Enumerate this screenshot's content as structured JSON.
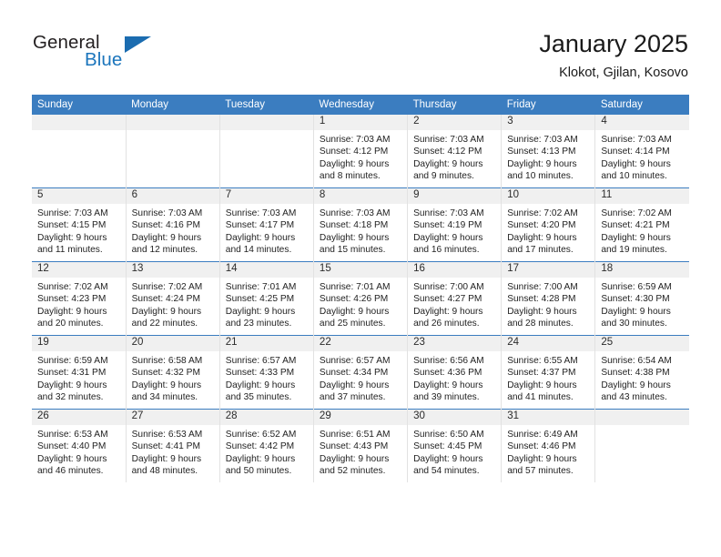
{
  "brand": {
    "word_one": "General",
    "word_two": "Blue",
    "accent_color": "#1b75bc",
    "triangle_color": "#1b6cb0",
    "triangle_icon": "triangle-right-icon"
  },
  "header": {
    "title": "January 2025",
    "subtitle": "Klokot, Gjilan, Kosovo"
  },
  "theme": {
    "header_row_bg": "#3b7dc0",
    "header_row_text": "#ffffff",
    "daynum_band_bg": "#f0f0f0",
    "cell_bg": "#ffffff",
    "grid_line": "#e2e2e2"
  },
  "calendar": {
    "weekday_headers": [
      "Sunday",
      "Monday",
      "Tuesday",
      "Wednesday",
      "Thursday",
      "Friday",
      "Saturday"
    ],
    "weeks": [
      [
        {
          "day": "",
          "lines": []
        },
        {
          "day": "",
          "lines": []
        },
        {
          "day": "",
          "lines": []
        },
        {
          "day": "1",
          "lines": [
            "Sunrise: 7:03 AM",
            "Sunset: 4:12 PM",
            "Daylight: 9 hours",
            "and 8 minutes."
          ]
        },
        {
          "day": "2",
          "lines": [
            "Sunrise: 7:03 AM",
            "Sunset: 4:12 PM",
            "Daylight: 9 hours",
            "and 9 minutes."
          ]
        },
        {
          "day": "3",
          "lines": [
            "Sunrise: 7:03 AM",
            "Sunset: 4:13 PM",
            "Daylight: 9 hours",
            "and 10 minutes."
          ]
        },
        {
          "day": "4",
          "lines": [
            "Sunrise: 7:03 AM",
            "Sunset: 4:14 PM",
            "Daylight: 9 hours",
            "and 10 minutes."
          ]
        }
      ],
      [
        {
          "day": "5",
          "lines": [
            "Sunrise: 7:03 AM",
            "Sunset: 4:15 PM",
            "Daylight: 9 hours",
            "and 11 minutes."
          ]
        },
        {
          "day": "6",
          "lines": [
            "Sunrise: 7:03 AM",
            "Sunset: 4:16 PM",
            "Daylight: 9 hours",
            "and 12 minutes."
          ]
        },
        {
          "day": "7",
          "lines": [
            "Sunrise: 7:03 AM",
            "Sunset: 4:17 PM",
            "Daylight: 9 hours",
            "and 14 minutes."
          ]
        },
        {
          "day": "8",
          "lines": [
            "Sunrise: 7:03 AM",
            "Sunset: 4:18 PM",
            "Daylight: 9 hours",
            "and 15 minutes."
          ]
        },
        {
          "day": "9",
          "lines": [
            "Sunrise: 7:03 AM",
            "Sunset: 4:19 PM",
            "Daylight: 9 hours",
            "and 16 minutes."
          ]
        },
        {
          "day": "10",
          "lines": [
            "Sunrise: 7:02 AM",
            "Sunset: 4:20 PM",
            "Daylight: 9 hours",
            "and 17 minutes."
          ]
        },
        {
          "day": "11",
          "lines": [
            "Sunrise: 7:02 AM",
            "Sunset: 4:21 PM",
            "Daylight: 9 hours",
            "and 19 minutes."
          ]
        }
      ],
      [
        {
          "day": "12",
          "lines": [
            "Sunrise: 7:02 AM",
            "Sunset: 4:23 PM",
            "Daylight: 9 hours",
            "and 20 minutes."
          ]
        },
        {
          "day": "13",
          "lines": [
            "Sunrise: 7:02 AM",
            "Sunset: 4:24 PM",
            "Daylight: 9 hours",
            "and 22 minutes."
          ]
        },
        {
          "day": "14",
          "lines": [
            "Sunrise: 7:01 AM",
            "Sunset: 4:25 PM",
            "Daylight: 9 hours",
            "and 23 minutes."
          ]
        },
        {
          "day": "15",
          "lines": [
            "Sunrise: 7:01 AM",
            "Sunset: 4:26 PM",
            "Daylight: 9 hours",
            "and 25 minutes."
          ]
        },
        {
          "day": "16",
          "lines": [
            "Sunrise: 7:00 AM",
            "Sunset: 4:27 PM",
            "Daylight: 9 hours",
            "and 26 minutes."
          ]
        },
        {
          "day": "17",
          "lines": [
            "Sunrise: 7:00 AM",
            "Sunset: 4:28 PM",
            "Daylight: 9 hours",
            "and 28 minutes."
          ]
        },
        {
          "day": "18",
          "lines": [
            "Sunrise: 6:59 AM",
            "Sunset: 4:30 PM",
            "Daylight: 9 hours",
            "and 30 minutes."
          ]
        }
      ],
      [
        {
          "day": "19",
          "lines": [
            "Sunrise: 6:59 AM",
            "Sunset: 4:31 PM",
            "Daylight: 9 hours",
            "and 32 minutes."
          ]
        },
        {
          "day": "20",
          "lines": [
            "Sunrise: 6:58 AM",
            "Sunset: 4:32 PM",
            "Daylight: 9 hours",
            "and 34 minutes."
          ]
        },
        {
          "day": "21",
          "lines": [
            "Sunrise: 6:57 AM",
            "Sunset: 4:33 PM",
            "Daylight: 9 hours",
            "and 35 minutes."
          ]
        },
        {
          "day": "22",
          "lines": [
            "Sunrise: 6:57 AM",
            "Sunset: 4:34 PM",
            "Daylight: 9 hours",
            "and 37 minutes."
          ]
        },
        {
          "day": "23",
          "lines": [
            "Sunrise: 6:56 AM",
            "Sunset: 4:36 PM",
            "Daylight: 9 hours",
            "and 39 minutes."
          ]
        },
        {
          "day": "24",
          "lines": [
            "Sunrise: 6:55 AM",
            "Sunset: 4:37 PM",
            "Daylight: 9 hours",
            "and 41 minutes."
          ]
        },
        {
          "day": "25",
          "lines": [
            "Sunrise: 6:54 AM",
            "Sunset: 4:38 PM",
            "Daylight: 9 hours",
            "and 43 minutes."
          ]
        }
      ],
      [
        {
          "day": "26",
          "lines": [
            "Sunrise: 6:53 AM",
            "Sunset: 4:40 PM",
            "Daylight: 9 hours",
            "and 46 minutes."
          ]
        },
        {
          "day": "27",
          "lines": [
            "Sunrise: 6:53 AM",
            "Sunset: 4:41 PM",
            "Daylight: 9 hours",
            "and 48 minutes."
          ]
        },
        {
          "day": "28",
          "lines": [
            "Sunrise: 6:52 AM",
            "Sunset: 4:42 PM",
            "Daylight: 9 hours",
            "and 50 minutes."
          ]
        },
        {
          "day": "29",
          "lines": [
            "Sunrise: 6:51 AM",
            "Sunset: 4:43 PM",
            "Daylight: 9 hours",
            "and 52 minutes."
          ]
        },
        {
          "day": "30",
          "lines": [
            "Sunrise: 6:50 AM",
            "Sunset: 4:45 PM",
            "Daylight: 9 hours",
            "and 54 minutes."
          ]
        },
        {
          "day": "31",
          "lines": [
            "Sunrise: 6:49 AM",
            "Sunset: 4:46 PM",
            "Daylight: 9 hours",
            "and 57 minutes."
          ]
        },
        {
          "day": "",
          "lines": []
        }
      ]
    ]
  }
}
